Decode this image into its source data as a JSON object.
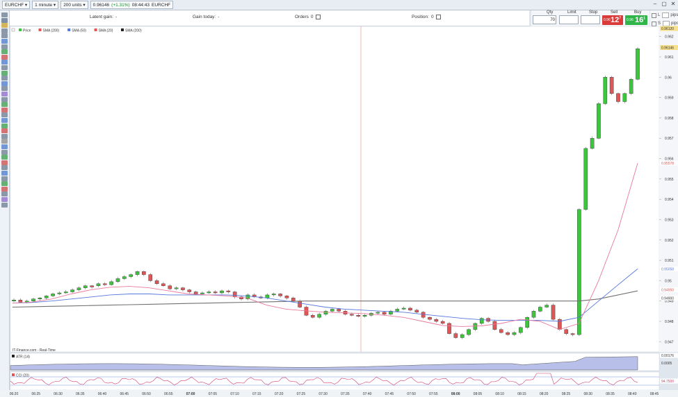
{
  "topbar": {
    "instrument": "EURCHF",
    "timeframe": "1 minute",
    "units": "200 units",
    "price": "0.96146",
    "change": "(+1.31%)",
    "time": "08:44:43",
    "symbol": "EURCHF"
  },
  "info": {
    "latent_label": "Latent gain:",
    "latent_value": "-",
    "gain_today_label": "Gain today:",
    "gain_today_value": "-",
    "orders_label": "Orders",
    "orders_value": "0",
    "position_label": "Position:",
    "position_value": "0"
  },
  "deal": {
    "qty_label": "Qty",
    "qty_value": "70",
    "limit_label": "Limit",
    "stop_label": "Stop",
    "sell_label": "Sell",
    "buy_label": "Buy",
    "sell_small": "0.96",
    "sell_big": "12",
    "sell_sup": "7",
    "buy_small": "0.96",
    "buy_big": "16",
    "buy_sup": "1"
  },
  "right_panel": {
    "l_label": "L",
    "s_label": "S",
    "unit_a": "pips",
    "unit_b": "pips"
  },
  "legend": {
    "price": "Price",
    "sma200a": "SMA (200)",
    "sma50": "SMA (50)",
    "sma20": "SMA (20)",
    "sma200b": "SMA (200)",
    "source": "IT-Finance.com - Real-Time",
    "atr": "ATR (14)",
    "cci": "CCI (20)"
  },
  "colors": {
    "bull": "#3cc63c",
    "bear": "#e05555",
    "sma20": "#e8799a",
    "sma50": "#5577dd",
    "sma200": "#707070",
    "atr_fill": "#b8bfe8",
    "cci": "#d04070",
    "crosshair": "#e88888"
  },
  "chart_data": {
    "type": "candlestick",
    "x_ticks": [
      "06:20",
      "06:25",
      "06:30",
      "06:35",
      "06:40",
      "06:45",
      "06:50",
      "06:55",
      "07:00",
      "07:05",
      "07:10",
      "07:15",
      "07:20",
      "07:25",
      "07:30",
      "07:35",
      "07:40",
      "07:45",
      "07:50",
      "07:55",
      "08:00",
      "08:05",
      "08:10",
      "08:15",
      "08:20",
      "08:25",
      "08:30",
      "08:35",
      "08:40",
      "08:45"
    ],
    "y_ticks": [
      "0.947",
      "0.948",
      "0.949",
      "0.95",
      "0.951",
      "0.952",
      "0.953",
      "0.954",
      "0.955",
      "0.956",
      "0.957",
      "0.958",
      "0.959",
      "0.96",
      "0.961",
      "0.962"
    ],
    "ylim": [
      0.9465,
      0.9625
    ],
    "price_tags": {
      "top": "0.96120",
      "last": "0.96146",
      "sma20": "0.95578",
      "sma50": "0.95058",
      "sma200a": "0.94950",
      "sma200b": "0.94900",
      "atr": "0.00176",
      "atr_tick": "0.0005",
      "cci": "94.7500"
    },
    "candles_coarse": [
      0.94905,
      0.94895,
      0.949,
      0.9491,
      0.94915,
      0.94925,
      0.94935,
      0.9494,
      0.94945,
      0.94955,
      0.94965,
      0.94975,
      0.94975,
      0.94985,
      0.9498,
      0.94995,
      0.9501,
      0.9502,
      0.9503,
      0.95045,
      0.9503,
      0.95,
      0.94985,
      0.94975,
      0.9496,
      0.94965,
      0.94955,
      0.94945,
      0.94935,
      0.9494,
      0.94945,
      0.9494,
      0.9495,
      0.94945,
      0.9492,
      0.9491,
      0.9493,
      0.9492,
      0.94915,
      0.9493,
      0.94935,
      0.94925,
      0.94915,
      0.949,
      0.9487,
      0.9483,
      0.9482,
      0.94835,
      0.9485,
      0.9486,
      0.9485,
      0.94835,
      0.9483,
      0.94825,
      0.9483,
      0.9484,
      0.94845,
      0.94835,
      0.9485,
      0.9486,
      0.94865,
      0.94855,
      0.94845,
      0.9482,
      0.9481,
      0.948,
      0.9479,
      0.9474,
      0.9472,
      0.94735,
      0.9476,
      0.9479,
      0.94815,
      0.948,
      0.9476,
      0.94745,
      0.94735,
      0.94745,
      0.9477,
      0.9482,
      0.9485,
      0.9487,
      0.9488,
      0.9481,
      0.9476,
      0.9474,
      0.94735,
      0.9535,
      0.9565,
      0.957,
      0.9587,
      0.96,
      0.9592,
      0.9588,
      0.9592,
      0.9599,
      0.9614
    ],
    "sma20": [
      0.9489,
      0.94895,
      0.9491,
      0.94935,
      0.94955,
      0.94968,
      0.94972,
      0.94965,
      0.9495,
      0.94935,
      0.9493,
      0.94925,
      0.94915,
      0.9488,
      0.9486,
      0.94852,
      0.94845,
      0.94842,
      0.94838,
      0.9483,
      0.9482,
      0.948,
      0.9478,
      0.94775,
      0.94778,
      0.9479,
      0.9481,
      0.948,
      0.9476,
      0.9479,
      0.95,
      0.9525,
      0.95578
    ],
    "sma50": [
      0.9489,
      0.94893,
      0.949,
      0.9491,
      0.9492,
      0.9493,
      0.94935,
      0.94935,
      0.9493,
      0.9493,
      0.9493,
      0.9493,
      0.94925,
      0.94915,
      0.949,
      0.94885,
      0.9487,
      0.9486,
      0.94855,
      0.9485,
      0.94845,
      0.94835,
      0.94825,
      0.94815,
      0.94808,
      0.94805,
      0.94805,
      0.94805,
      0.948,
      0.9482,
      0.949,
      0.9498,
      0.95058
    ],
    "sma200": [
      0.9487,
      0.94872,
      0.94874,
      0.94876,
      0.94878,
      0.9488,
      0.94882,
      0.94884,
      0.94886,
      0.94888,
      0.9489,
      0.94892,
      0.94894,
      0.94896,
      0.94898,
      0.949,
      0.949,
      0.949,
      0.949,
      0.949,
      0.949,
      0.949,
      0.949,
      0.949,
      0.949,
      0.949,
      0.949,
      0.949,
      0.949,
      0.949,
      0.9491,
      0.9493,
      0.9495
    ]
  }
}
